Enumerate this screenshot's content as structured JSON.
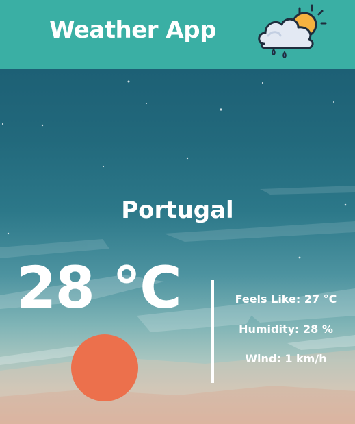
{
  "header": {
    "title": "Weather App",
    "logo_icon": "cloud-sun-rain-icon"
  },
  "main": {
    "location": "Portugal",
    "temperature": "28 °C",
    "condition_icon": "sun-icon",
    "details": {
      "feels_like": "Feels Like: 27 °C",
      "humidity": "Humidity: 28 %",
      "wind": "Wind: 1 km/h"
    }
  },
  "colors": {
    "header_bg": "#3aafa4",
    "sun": "#ec704c",
    "text": "#ffffff"
  }
}
